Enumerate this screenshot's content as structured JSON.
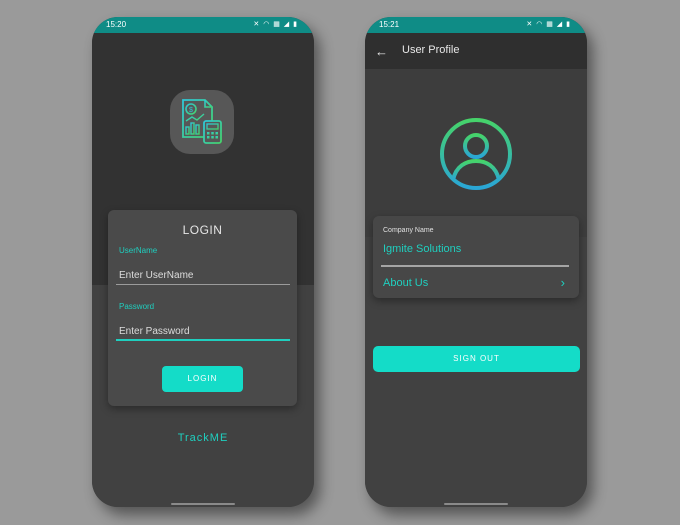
{
  "login_screen": {
    "status_bar": {
      "time": "15:20",
      "icons_text": "✕ ◠ ▦ ◢ ▮"
    },
    "app_icon": {
      "name": "finance-report-icon"
    },
    "card_title": "LOGIN",
    "username": {
      "label": "UserName",
      "placeholder": "Enter UserName",
      "value": ""
    },
    "password": {
      "label": "Password",
      "placeholder": "Enter Password",
      "value": ""
    },
    "login_button": "LOGIN",
    "brand": "TrackME"
  },
  "profile_screen": {
    "status_bar": {
      "time": "15:21",
      "icons_text": "✕ ◠ ▦ ◢ ▮"
    },
    "app_bar": {
      "back": "←",
      "title": "User Profile"
    },
    "company": {
      "label": "Company Name",
      "value": "Igmite Solutions"
    },
    "about": {
      "label": "About Us",
      "chevron": "›"
    },
    "sign_out_button": "SIGN OUT"
  },
  "colors": {
    "accent": "#14dcc8",
    "accent_text": "#1fcfbf",
    "status_bar": "#0f8c86",
    "background": "#9a9a9a"
  }
}
